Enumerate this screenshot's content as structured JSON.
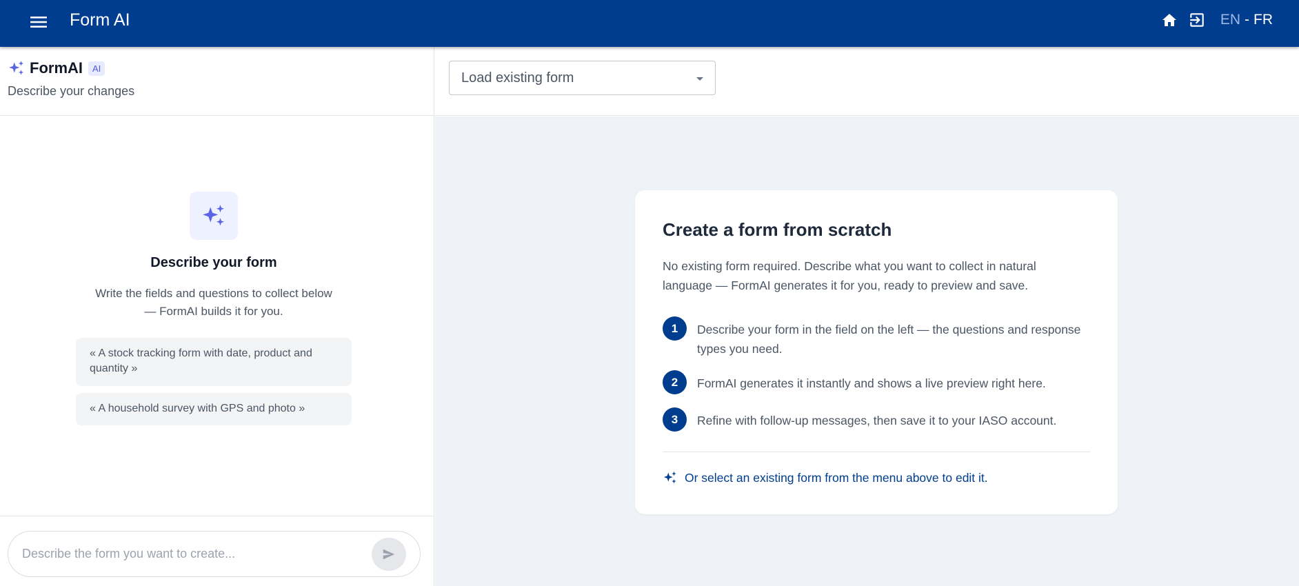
{
  "appbar": {
    "title": "Form AI",
    "lang_en": "EN",
    "lang_sep": "-",
    "lang_fr": "FR"
  },
  "chat_panel": {
    "brand_name": "FormAI",
    "badge": "AI",
    "subtitle": "Describe your changes",
    "empty_title": "Describe your form",
    "empty_text": "Write the fields and questions to collect below — FormAI builds it for you.",
    "suggestions": [
      "« A stock tracking form with date, product and quantity »",
      "« A household survey with GPS and photo »"
    ],
    "input_placeholder": "Describe the form you want to create..."
  },
  "form_select": {
    "placeholder": "Load existing form"
  },
  "card": {
    "title": "Create a form from scratch",
    "intro": "No existing form required. Describe what you want to collect in natural language — FormAI generates it for you, ready to preview and save.",
    "steps": [
      {
        "num": "1",
        "text": "Describe your form in the field on the left — the questions and response types you need."
      },
      {
        "num": "2",
        "text": "FormAI generates it instantly and shows a live preview right here."
      },
      {
        "num": "3",
        "text": "Refine with follow-up messages, then save it to your IASO account."
      }
    ],
    "link": "Or select an existing form from the menu above to edit it."
  },
  "colors": {
    "primary": "#003d8f",
    "accent": "#5b63e6",
    "background": "#eff2f7"
  },
  "icons": [
    "menu-icon",
    "home-icon",
    "logout-icon",
    "sparkles-icon",
    "send-icon",
    "caret-down-icon"
  ]
}
